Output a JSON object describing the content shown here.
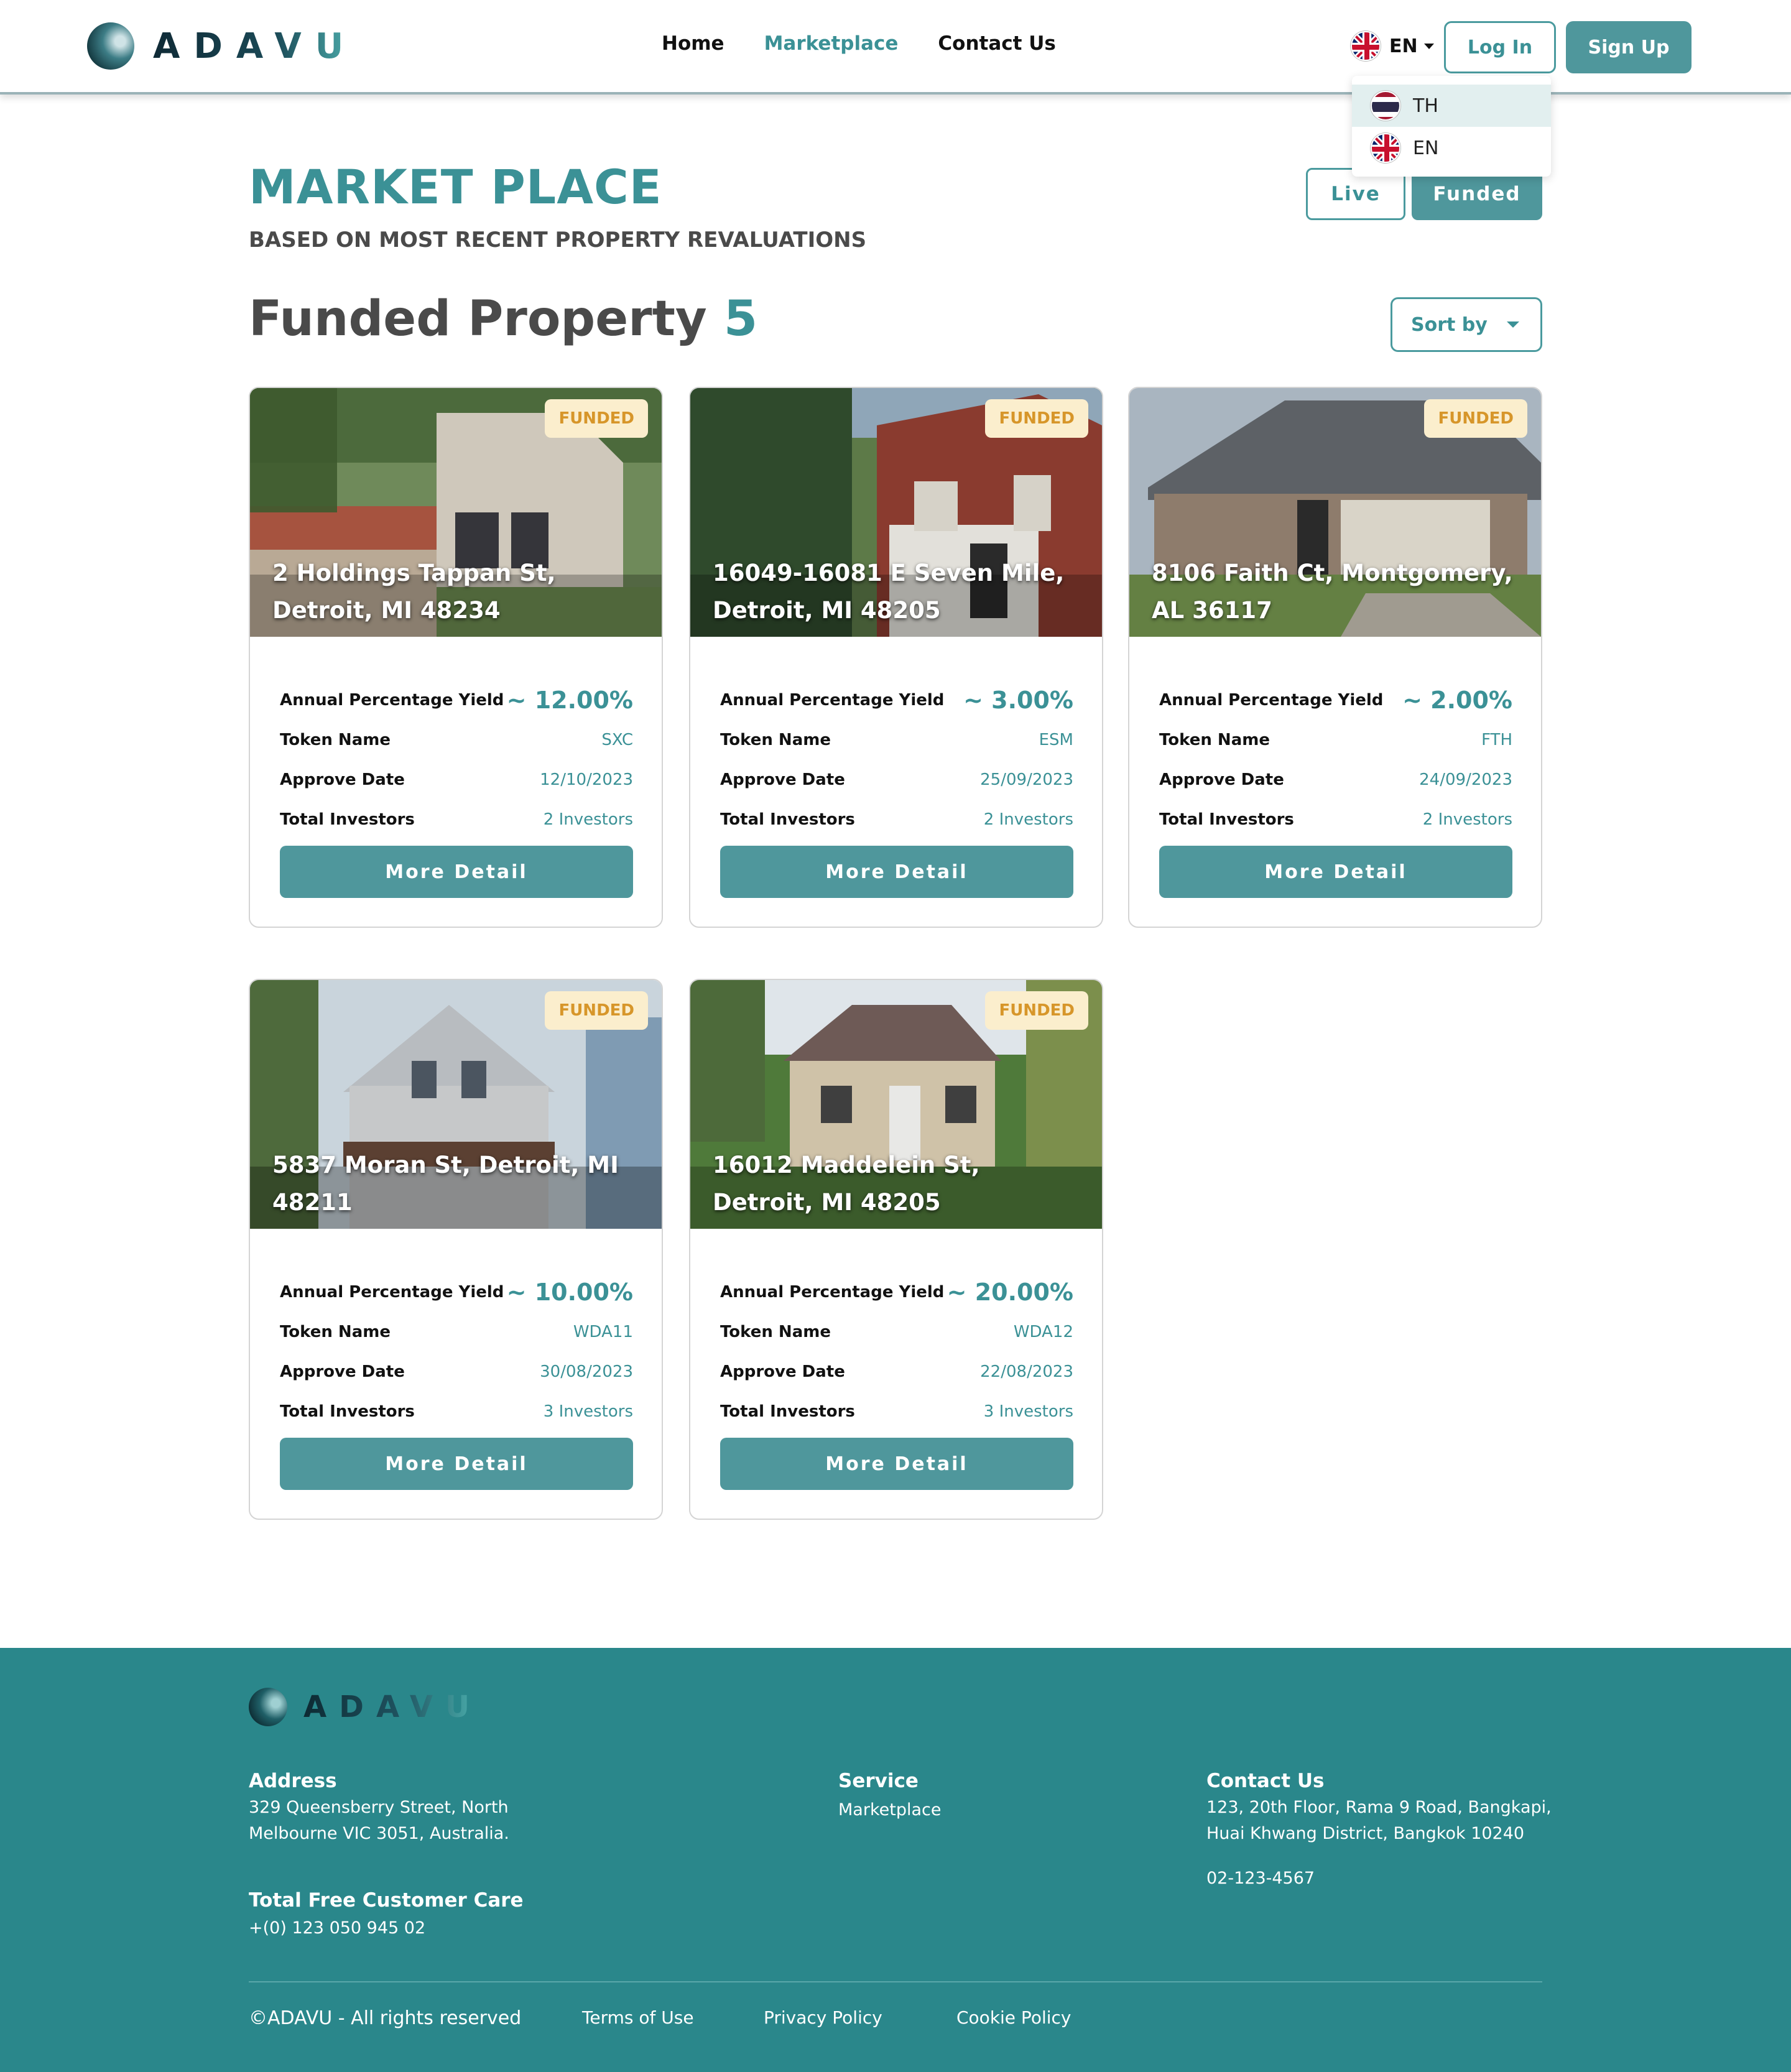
{
  "brand": {
    "name": "ADAVU"
  },
  "nav": [
    {
      "label": "Home",
      "active": false
    },
    {
      "label": "Marketplace",
      "active": true
    },
    {
      "label": "Contact Us",
      "active": false
    }
  ],
  "language": {
    "current": "EN",
    "options": [
      {
        "code": "TH",
        "icon": "thailand-flag-icon",
        "highlighted": true
      },
      {
        "code": "EN",
        "icon": "uk-flag-icon",
        "highlighted": false
      }
    ]
  },
  "auth": {
    "login_label": "Log In",
    "signup_label": "Sign Up"
  },
  "page": {
    "title": "MARKET PLACE",
    "subtitle": "BASED ON MOST RECENT PROPERTY REVALUATIONS",
    "toggle": {
      "live_label": "Live",
      "funded_label": "Funded",
      "selected": "Funded"
    },
    "heading": "Funded Property",
    "count": "5",
    "sort_label": "Sort by"
  },
  "labels": {
    "apy": "Annual Percentage Yield",
    "token": "Token Name",
    "approve": "Approve Date",
    "investors": "Total Investors",
    "more": "More Detail"
  },
  "properties": [
    {
      "badge": "FUNDED",
      "address": "2 Holdings Tappan St, Detroit, MI 48234",
      "apy": "~ 12.00%",
      "token": "SXC",
      "approve_date": "12/10/2023",
      "investors": "2 Investors"
    },
    {
      "badge": "FUNDED",
      "address": "16049-16081 E Seven Mile, Detroit, MI 48205",
      "apy": "~ 3.00%",
      "token": "ESM",
      "approve_date": "25/09/2023",
      "investors": "2 Investors"
    },
    {
      "badge": "FUNDED",
      "address": "8106 Faith Ct, Montgomery, AL 36117",
      "apy": "~ 2.00%",
      "token": "FTH",
      "approve_date": "24/09/2023",
      "investors": "2 Investors"
    },
    {
      "badge": "FUNDED",
      "address": "5837 Moran St, Detroit, MI 48211",
      "apy": "~ 10.00%",
      "token": "WDA11",
      "approve_date": "30/08/2023",
      "investors": "3 Investors"
    },
    {
      "badge": "FUNDED",
      "address": "16012 Maddelein St, Detroit, MI 48205",
      "apy": "~ 20.00%",
      "token": "WDA12",
      "approve_date": "22/08/2023",
      "investors": "3 Investors"
    }
  ],
  "footer": {
    "address_title": "Address",
    "address_line1": "329 Queensberry Street, North",
    "address_line2": "Melbourne VIC 3051, Australia.",
    "care_title": "Total Free Customer Care",
    "care_phone": "+(0) 123 050 945 02",
    "service_title": "Service",
    "service_link": "Marketplace",
    "contact_title": "Contact Us",
    "contact_line1": "123, 20th Floor, Rama 9 Road, Bangkapi,",
    "contact_line2": "Huai Khwang District, Bangkok 10240",
    "contact_phone": "02-123-4567",
    "copyright": "©ADAVU - All rights reserved",
    "terms": "Terms of Use",
    "privacy": "Privacy Policy",
    "cookie": "Cookie Policy"
  },
  "colors": {
    "accent": "#3b9196",
    "button": "#4f979c",
    "footer_bg": "#2a878b",
    "badge_bg": "#fbeecd",
    "badge_text": "#d7962a"
  }
}
